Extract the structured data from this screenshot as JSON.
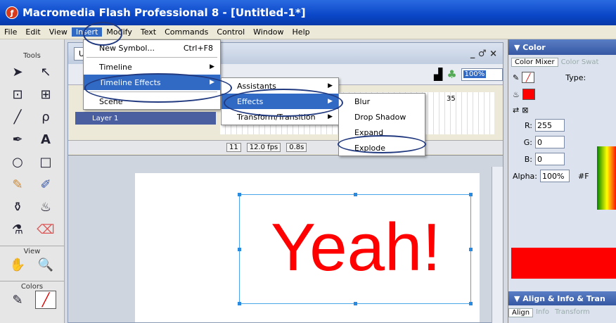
{
  "window": {
    "title": "Macromedia Flash Professional 8 - [Untitled-1*]"
  },
  "menubar": [
    "File",
    "Edit",
    "View",
    "Insert",
    "Modify",
    "Text",
    "Commands",
    "Control",
    "Window",
    "Help"
  ],
  "tools": {
    "header": "Tools",
    "view_header": "View",
    "colors_header": "Colors"
  },
  "document": {
    "tab": "Ur",
    "tab2": "T",
    "zoom": "100%",
    "window_controls": "_ ♂ ×"
  },
  "timeline": {
    "layer_name": "Layer 1",
    "frame_label": "35",
    "frame_number": "11",
    "fps": "12.0 fps",
    "time": "0.8s"
  },
  "stage": {
    "text": "Yeah!",
    "text_color": "#ff0000"
  },
  "insert_menu": {
    "items": [
      {
        "label": "New Symbol...",
        "shortcut": "Ctrl+F8"
      },
      {
        "label": "Timeline"
      },
      {
        "label": "Timeline Effects"
      },
      {
        "label": "Scene"
      }
    ]
  },
  "timeline_effects_menu": [
    "Assistants",
    "Effects",
    "Transform/Transition"
  ],
  "effects_menu": [
    "Blur",
    "Drop Shadow",
    "Expand",
    "Explode"
  ],
  "color_panel": {
    "title": "▼ Color",
    "tabs": [
      "Color Mixer",
      "Color Swat"
    ],
    "type_label": "Type:",
    "r_label": "R:",
    "r_value": "255",
    "g_label": "G:",
    "g_value": "0",
    "b_label": "B:",
    "b_value": "0",
    "alpha_label": "Alpha:",
    "alpha_value": "100%",
    "hex_value": "#F",
    "fill_color": "#ff0000"
  },
  "align_panel": {
    "title": "▼ Align & Info & Tran",
    "tabs": [
      "Align",
      "Info",
      "Transform"
    ]
  }
}
